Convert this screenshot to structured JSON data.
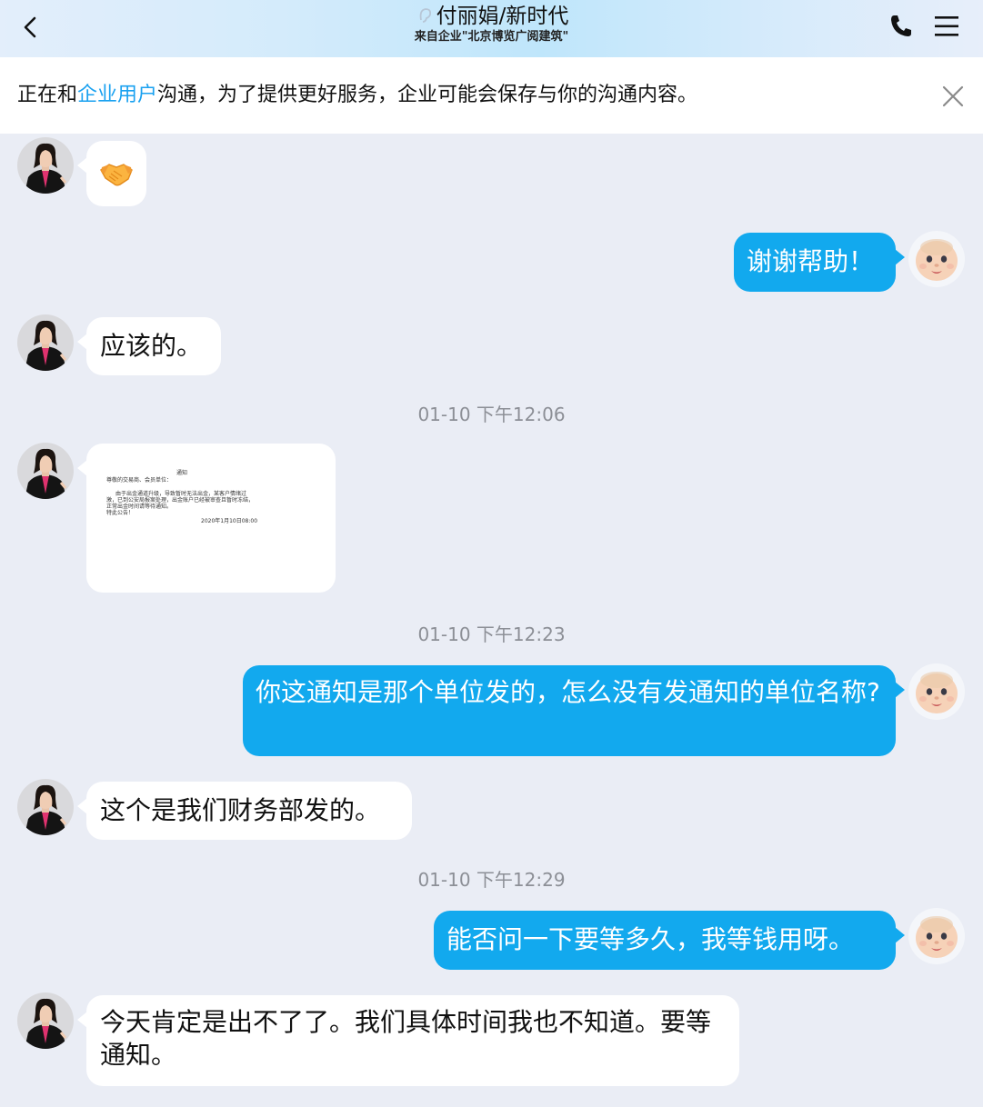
{
  "header": {
    "title": "付丽娟/新时代",
    "subtitle": "来自企业\"北京博览广阅建筑\"",
    "icons": {
      "back": "chevron-left-icon",
      "phone": "phone-icon",
      "menu": "hamburger-menu-icon",
      "ear": "ear-icon"
    }
  },
  "notice": {
    "prefix": "正在和",
    "link": "企业用户",
    "suffix": "沟通，为了提供更好服务，企业可能会保存与你的沟通内容。",
    "close_icon": "close-icon",
    "link_color": "#1aa1f0"
  },
  "colors": {
    "outgoing_bubble": "#12a9ee",
    "incoming_bubble": "#ffffff",
    "background": "#eaedf5"
  },
  "messages": {
    "m1_emoji": "handshake-emoji",
    "m2_text": "谢谢帮助！",
    "m3_text": "应该的。",
    "ts1": "01-10 下午12:06",
    "m4_image": {
      "title": "通知",
      "greeting": "尊敬的交易商、会员单位：",
      "body_line1": "由于出金通道升级，导致暂时无法出金，某客户情绪过",
      "body_line2": "激，已到公安局报案处理，出金账户已经被审查且暂时冻结，",
      "body_line3": "正常出金时间请等待通知。",
      "closing": "特此公告！",
      "date": "2020年1月10日08:00"
    },
    "ts2": "01-10 下午12:23",
    "m5_text": "你这通知是那个单位发的，怎么没有发通知的单位名称?",
    "m6_text": "这个是我们财务部发的。",
    "ts3": "01-10 下午12:29",
    "m7_text": "能否问一下要等多久，我等钱用呀。",
    "m8_text": "今天肯定是出不了了。我们具体时间我也不知道。要等通知。"
  }
}
